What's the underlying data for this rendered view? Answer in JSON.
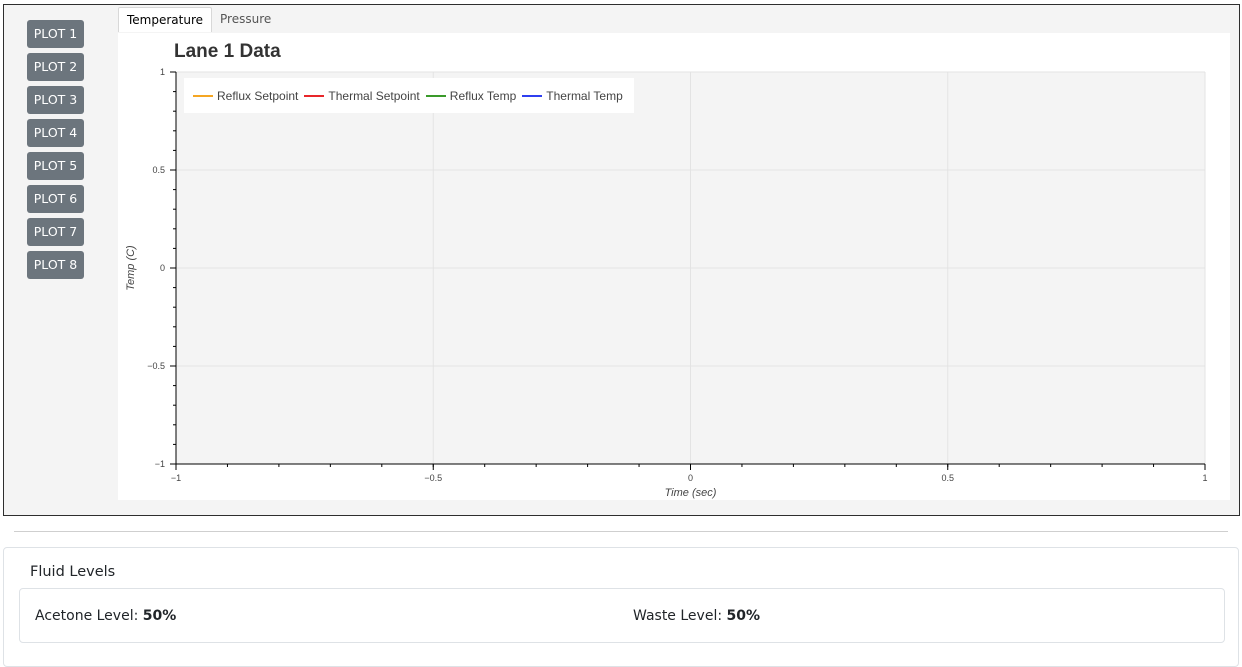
{
  "plot_buttons": [
    "PLOT 1",
    "PLOT 2",
    "PLOT 3",
    "PLOT 4",
    "PLOT 5",
    "PLOT 6",
    "PLOT 7",
    "PLOT 8"
  ],
  "tabs": [
    {
      "label": "Temperature",
      "active": true
    },
    {
      "label": "Pressure",
      "active": false
    }
  ],
  "chart_data": {
    "type": "line",
    "title": "Lane 1 Data",
    "xlabel": "Time (sec)",
    "ylabel": "Temp (C)",
    "xlim": [
      -1,
      1
    ],
    "ylim": [
      -1,
      1
    ],
    "x_ticks": [
      -1,
      -0.5,
      0,
      0.5,
      1
    ],
    "y_ticks": [
      -1,
      -0.5,
      0,
      0.5,
      1
    ],
    "x_tick_labels": [
      "−1",
      "−0.5",
      "0",
      "0.5",
      "1"
    ],
    "y_tick_labels": [
      "−1",
      "−0.5",
      "0",
      "0.5",
      "1"
    ],
    "grid": true,
    "legend_position": "top-left",
    "series": [
      {
        "name": "Reflux Setpoint",
        "color": "#f5a623",
        "x": [],
        "y": []
      },
      {
        "name": "Thermal Setpoint",
        "color": "#e8262a",
        "x": [],
        "y": []
      },
      {
        "name": "Reflux Temp",
        "color": "#3a9a2a",
        "x": [],
        "y": []
      },
      {
        "name": "Thermal Temp",
        "color": "#2f3ff0",
        "x": [],
        "y": []
      }
    ]
  },
  "fluid_levels": {
    "title": "Fluid Levels",
    "acetone_label": "Acetone Level:",
    "acetone_value": "50%",
    "waste_label": "Waste Level:",
    "waste_value": "50%"
  }
}
